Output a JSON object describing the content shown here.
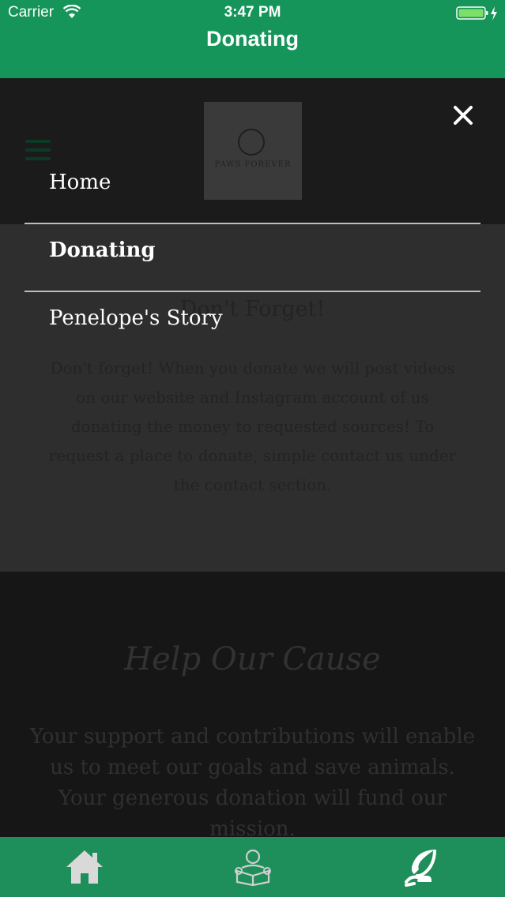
{
  "status_bar": {
    "carrier": "Carrier",
    "time": "3:47 PM"
  },
  "nav": {
    "title": "Donating"
  },
  "logo": {
    "text": "PAWS FOREVER"
  },
  "page": {
    "section_heading": "Don't Forget!",
    "section_text": "Don't forget! When you donate we will post videos on our website and Instagram account of us donating the money to requested sources! To request a place to donate, simple contact us under the contact section.",
    "cause_title": "Help Our Cause",
    "cause_text": "Your support and contributions will enable us to meet our goals and save animals. Your generous donation will fund our mission."
  },
  "menu": {
    "items": [
      {
        "label": "Home",
        "active": false
      },
      {
        "label": "Donating",
        "active": true
      },
      {
        "label": "Penelope's Story",
        "active": false
      }
    ]
  },
  "tabbar": {
    "tabs": [
      {
        "icon": "home-icon"
      },
      {
        "icon": "reading-person-icon"
      },
      {
        "icon": "leaf-hand-icon"
      }
    ]
  },
  "colors": {
    "brand_green": "#15955a",
    "tabbar_green": "#1e8f5a"
  }
}
